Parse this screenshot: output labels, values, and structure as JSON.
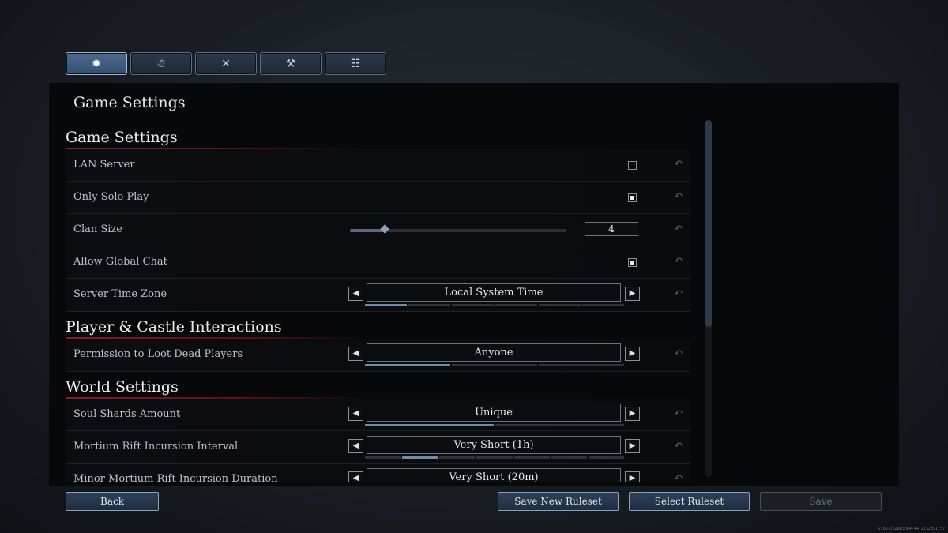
{
  "tabs": [
    {
      "name": "settings",
      "icon": "gear-icon",
      "glyph": "✹",
      "active": true
    },
    {
      "name": "character",
      "icon": "character-icon",
      "glyph": "☃",
      "active": false
    },
    {
      "name": "combat",
      "icon": "crossed-swords-icon",
      "glyph": "✕",
      "active": false
    },
    {
      "name": "crafting",
      "icon": "hammer-icon",
      "glyph": "⚒",
      "active": false
    },
    {
      "name": "codex",
      "icon": "book-icon",
      "glyph": "☷",
      "active": false
    }
  ],
  "panel": {
    "title": "Game Settings"
  },
  "sections": {
    "game": {
      "title": "Game Settings",
      "lan_server": {
        "label": "LAN Server",
        "checked": false
      },
      "only_solo": {
        "label": "Only Solo Play",
        "checked": true
      },
      "clan_size": {
        "label": "Clan Size",
        "value": "4",
        "fraction": 0.16
      },
      "global_chat": {
        "label": "Allow Global Chat",
        "checked": true
      },
      "time_zone": {
        "label": "Server Time Zone",
        "value": "Local System Time",
        "options": 6,
        "selected": 0
      }
    },
    "player": {
      "title": "Player & Castle Interactions",
      "loot": {
        "label": "Permission to Loot Dead Players",
        "value": "Anyone",
        "options": 3,
        "selected": 0
      }
    },
    "world": {
      "title": "World Settings",
      "soul_shards": {
        "label": "Soul Shards Amount",
        "value": "Unique",
        "options": 2,
        "selected": 0
      },
      "rift_interval": {
        "label": "Mortium Rift Incursion Interval",
        "value": "Very Short (1h)",
        "options": 7,
        "selected": 1
      },
      "rift_duration": {
        "label": "Minor Mortium Rift Incursion Duration",
        "value": "Very Short (20m)"
      }
    }
  },
  "reset_icon": "reset-icon",
  "buttons": {
    "back": "Back",
    "save_new": "Save New Ruleset",
    "select": "Select Ruleset",
    "save": "Save"
  },
  "colors": {
    "accent": "#8a1a24",
    "button_border": "#8aa2c0",
    "pager_active": "#6e8cb0"
  },
  "version": "v1657762ab3d84-44-2232391757"
}
